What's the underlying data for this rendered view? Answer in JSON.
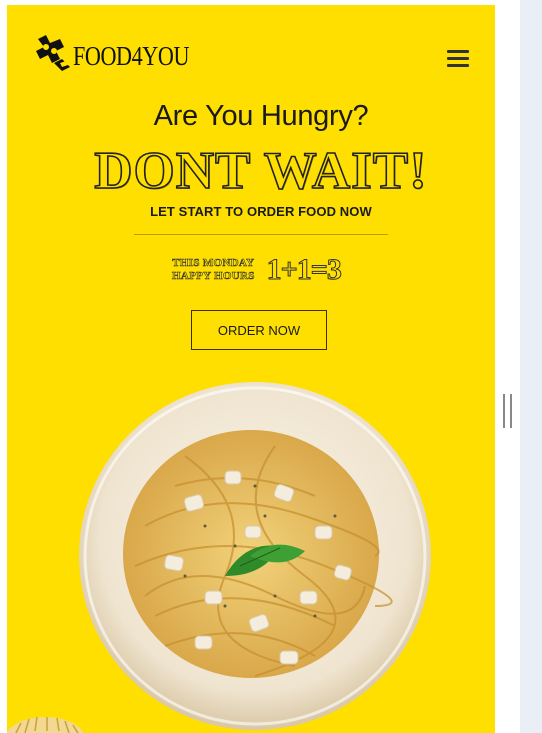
{
  "brand": {
    "name": "FOOD4YOU",
    "logo_icon": "chef-hat-logo-icon"
  },
  "nav": {
    "menu_icon": "hamburger-menu-icon"
  },
  "hero": {
    "headline": "Are You Hungry?",
    "title": "DONT WAIT!",
    "subtitle": "LET START TO ORDER FOOD NOW",
    "promo": {
      "line1": "THIS MONDAY",
      "line2": "HAPPY HOURS",
      "offer": "1+1=3"
    },
    "cta_label": "ORDER NOW",
    "image": "spaghetti-plate-image"
  },
  "colors": {
    "background": "#ffdf00",
    "text": "#1a1a1a",
    "plate": "#f7efe0"
  }
}
